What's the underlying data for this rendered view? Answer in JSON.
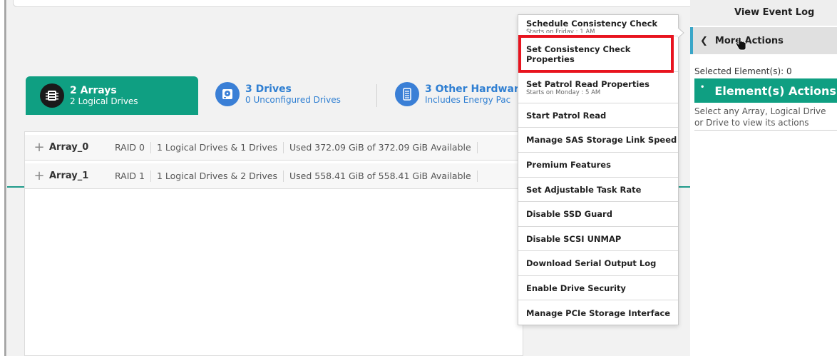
{
  "tabs": {
    "arrays": {
      "title": "2 Arrays",
      "subtitle": "2 Logical Drives",
      "icon": "array-chip-icon"
    },
    "drives": {
      "title": "3 Drives",
      "subtitle": "0 Unconfigured Drives",
      "icon": "hard-drive-icon"
    },
    "hardware": {
      "title": "3 Other Hardwar",
      "subtitle": "Includes Energy Pac",
      "icon": "hardware-icon"
    }
  },
  "arrays": [
    {
      "name": "Array_0",
      "raid": "RAID 0",
      "summary": "1 Logical Drives & 1 Drives",
      "usage": "Used 372.09 GiB of 372.09 GiB Available"
    },
    {
      "name": "Array_1",
      "raid": "RAID 1",
      "summary": "1 Logical Drives & 2 Drives",
      "usage": "Used 558.41 GiB of 558.41 GiB Available"
    }
  ],
  "menu": {
    "items": [
      {
        "label": "Schedule Consistency Check",
        "sub": "Starts on Friday : 1 AM"
      },
      {
        "label": "Set Consistency Check Properties",
        "sub": ""
      },
      {
        "label": "Set Patrol Read Properties",
        "sub": "Starts on Monday : 5 AM"
      },
      {
        "label": "Start Patrol Read",
        "sub": ""
      },
      {
        "label": "Manage SAS Storage Link Speed",
        "sub": ""
      },
      {
        "label": "Premium Features",
        "sub": ""
      },
      {
        "label": "Set Adjustable Task Rate",
        "sub": ""
      },
      {
        "label": "Disable SSD Guard",
        "sub": ""
      },
      {
        "label": "Disable SCSI UNMAP",
        "sub": ""
      },
      {
        "label": "Download Serial Output Log",
        "sub": ""
      },
      {
        "label": "Enable Drive Security",
        "sub": ""
      },
      {
        "label": "Manage PCIe Storage Interface",
        "sub": ""
      }
    ]
  },
  "right_panel": {
    "view_event_log": "View Event Log",
    "more_actions": "More Actions",
    "selected_elements": "Selected Element(s): 0",
    "element_actions_header": "Element(s) Actions",
    "hint": "Select any Array, Logical Drive or Drive to view its actions"
  },
  "colors": {
    "accent_green": "#0f9f82",
    "highlight_red": "#e8141f",
    "link_blue": "#2f7fd2"
  }
}
